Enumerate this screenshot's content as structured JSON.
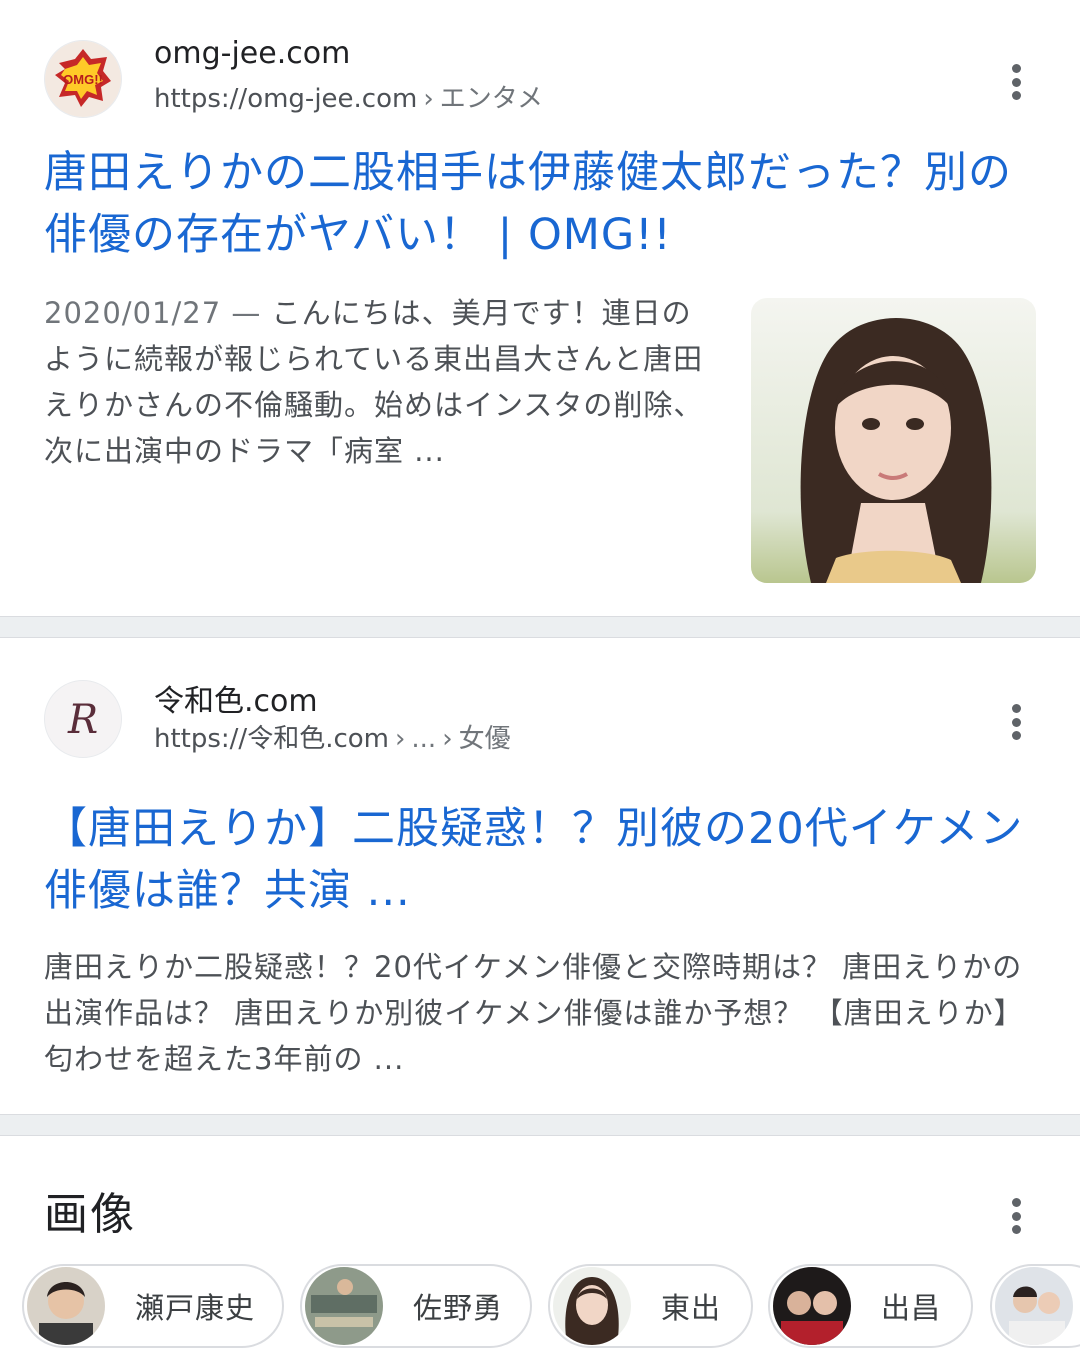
{
  "results": [
    {
      "site_name": "omg-jee.com",
      "url": "https://omg-jee.com",
      "breadcrumb": "エンタメ",
      "favicon_text": "OMG!!",
      "title": "唐田えりかの二股相手は伊藤健太郎だった？別の俳優の存在がヤバい！ | OMG!!",
      "date": "2020/01/27",
      "date_sep": " — ",
      "snippet": "こんにちは、美月です！連日のように続報が報じられている東出昌大さんと唐田えりかさんの不倫騒動。始めはインスタの削除、次に出演中のドラマ「病室 ..."
    },
    {
      "site_name": "令和色.com",
      "url": "https://令和色.com",
      "breadcrumb_ellipsis": "...",
      "breadcrumb": "女優",
      "favicon_text": "R",
      "title": "【唐田えりか】二股疑惑！？別彼の20代イケメン俳優は誰？共演 ...",
      "snippet": "唐田えりか二股疑惑！？20代イケメン俳優と交際時期は？ 唐田えりかの出演作品は？ 唐田えりか別彼イケメン俳優は誰か予想？ 【唐田えりか】匂わせを超えた3年前の ..."
    }
  ],
  "images": {
    "title": "画像",
    "chips": [
      {
        "label": "瀬戸康史"
      },
      {
        "label": "佐野勇"
      },
      {
        "label": "東出"
      },
      {
        "label": "出昌"
      },
      {
        "label": ""
      }
    ]
  },
  "colors": {
    "link": "#1967d2",
    "snippet": "#4d5156",
    "divider": "#eceff1"
  }
}
